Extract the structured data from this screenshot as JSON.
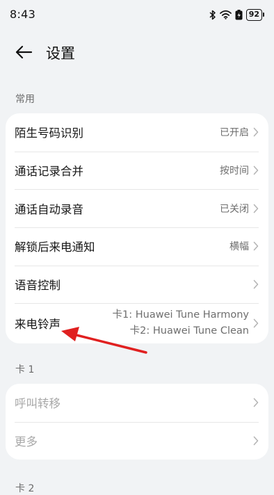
{
  "status_bar": {
    "time": "8:43",
    "battery_level": "92",
    "icons": [
      "bluetooth-icon",
      "wifi-icon",
      "battery-saver-icon",
      "battery-icon"
    ]
  },
  "header": {
    "title": "设置",
    "back_icon": "back-arrow-icon"
  },
  "sections": {
    "common": {
      "label": "常用",
      "items": [
        {
          "label": "陌生号码识别",
          "value": "已开启"
        },
        {
          "label": "通话记录合并",
          "value": "按时间"
        },
        {
          "label": "通话自动录音",
          "value": "已关闭"
        },
        {
          "label": "解锁后来电通知",
          "value": "横幅"
        },
        {
          "label": "语音控制",
          "value": ""
        },
        {
          "label": "来电铃声",
          "value_line1": "卡1: Huawei Tune Harmony",
          "value_line2": "卡2: Huawei Tune Clean"
        }
      ]
    },
    "card1": {
      "label": "卡 1",
      "items": [
        {
          "label": "呼叫转移"
        },
        {
          "label": "更多"
        }
      ]
    },
    "card2": {
      "label": "卡 2"
    }
  },
  "colors": {
    "background": "#f1f3f5",
    "card": "#ffffff",
    "annotation_arrow": "#e02020"
  }
}
